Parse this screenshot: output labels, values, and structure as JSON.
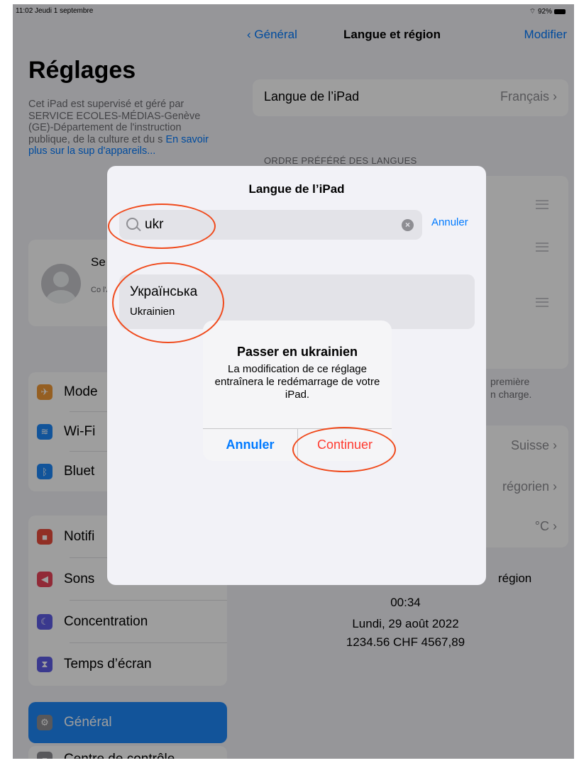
{
  "status": {
    "time_date": "11:02  Jeudi 1 septembre",
    "battery": "92%"
  },
  "sidebar": {
    "title": "Réglages",
    "description": "Cet iPad est supervisé et géré par SERVICE ECOLES-MÉDIAS-Genève (GE)-Département de l'instruction publique, de la culture et du s",
    "description_link": "En savoir plus sur la sup",
    "description_link2": "d'appareils...",
    "profile_title": "Se à l'",
    "profile_sub": "Co l'Ap d'a",
    "items_group1": [
      {
        "label": "Mode",
        "icon": "airplane-icon",
        "color": "#f19a37"
      },
      {
        "label": "Wi-Fi",
        "icon": "wifi-icon",
        "color": "#1d88f8"
      },
      {
        "label": "Bluet",
        "icon": "bluetooth-icon",
        "color": "#1d88f8"
      }
    ],
    "items_group2": [
      {
        "label": "Notifi",
        "icon": "notifications-icon",
        "color": "#eb4d3d"
      },
      {
        "label": "Sons",
        "icon": "sounds-icon",
        "color": "#eb445a"
      },
      {
        "label": "Concentration",
        "icon": "moon-icon",
        "color": "#5e5ce6"
      },
      {
        "label": "Temps d’écran",
        "icon": "hourglass-icon",
        "color": "#5e5ce6"
      }
    ],
    "active_item": {
      "label": "Général",
      "icon": "gear-icon"
    },
    "next_item": {
      "label": "Centre de contrôle"
    }
  },
  "main": {
    "back_label": "Général",
    "title": "Langue et région",
    "edit_label": "Modifier",
    "ipad_language_label": "Langue de l’iPad",
    "ipad_language_value": "Français",
    "preferred_header": "ORDRE PRÉFÉRÉ DES LANGUES",
    "footer_note_1": "première",
    "footer_note_2": "n charge.",
    "region_value": "Suisse",
    "calendar_value": "régorien",
    "temperature_value": "°C",
    "format_header": "région",
    "preview_time": "00:34",
    "preview_date": "Lundi, 29 août 2022",
    "preview_numbers": "1234.56 CHF   4567,89"
  },
  "sheet": {
    "title": "Langue de l’iPad",
    "search_value": "ukr",
    "cancel_label": "Annuler",
    "result_native": "Українська",
    "result_translated": "Ukrainien"
  },
  "alert": {
    "title": "Passer en ukrainien",
    "message": "La modification de ce réglage entraînera le redémarrage de votre iPad.",
    "cancel_label": "Annuler",
    "continue_label": "Continuer"
  }
}
